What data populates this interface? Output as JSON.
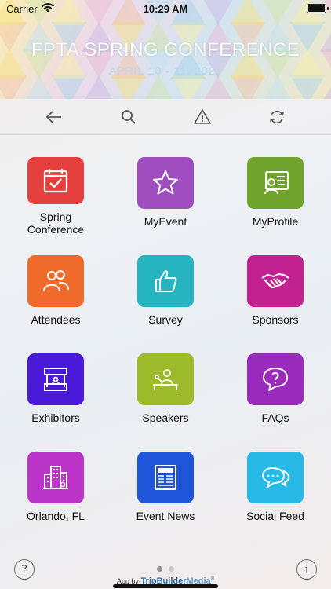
{
  "status": {
    "carrier": "Carrier",
    "time": "10:29 AM"
  },
  "banner": {
    "title": "FPTA SPRING CONFERENCE",
    "date": "APRIL 10 - 11, 2021"
  },
  "toolbar": [
    "back-arrow-icon",
    "search-icon",
    "warning-icon",
    "refresh-icon"
  ],
  "tiles": [
    {
      "label": "Spring\nConference",
      "icon": "calendar-check-icon",
      "color": "#e4403e"
    },
    {
      "label": "MyEvent",
      "icon": "star-icon",
      "color": "#9d4dbd"
    },
    {
      "label": "MyProfile",
      "icon": "profile-card-icon",
      "color": "#70a32b"
    },
    {
      "label": "Attendees",
      "icon": "people-icon",
      "color": "#ef6a2b"
    },
    {
      "label": "Survey",
      "icon": "thumbs-up-icon",
      "color": "#27b4c1"
    },
    {
      "label": "Sponsors",
      "icon": "handshake-icon",
      "color": "#c1228f"
    },
    {
      "label": "Exhibitors",
      "icon": "booth-icon",
      "color": "#4a1ad8"
    },
    {
      "label": "Speakers",
      "icon": "speaker-icon",
      "color": "#9dba2a"
    },
    {
      "label": "FAQs",
      "icon": "question-bubble-icon",
      "color": "#9a2bbd"
    },
    {
      "label": "Orlando, FL",
      "icon": "city-icon",
      "color": "#bb35c9"
    },
    {
      "label": "Event News",
      "icon": "newspaper-icon",
      "color": "#1f56d9"
    },
    {
      "label": "Social Feed",
      "icon": "chat-bubbles-icon",
      "color": "#27b8e6"
    }
  ],
  "footer": {
    "help_symbol": "?",
    "info_symbol": "i",
    "credit_prefix": "App by",
    "brand_main": "TripBuilder",
    "brand_accent": "Media",
    "trademark": "®",
    "page_indicator": {
      "current": 1,
      "total": 2
    }
  }
}
